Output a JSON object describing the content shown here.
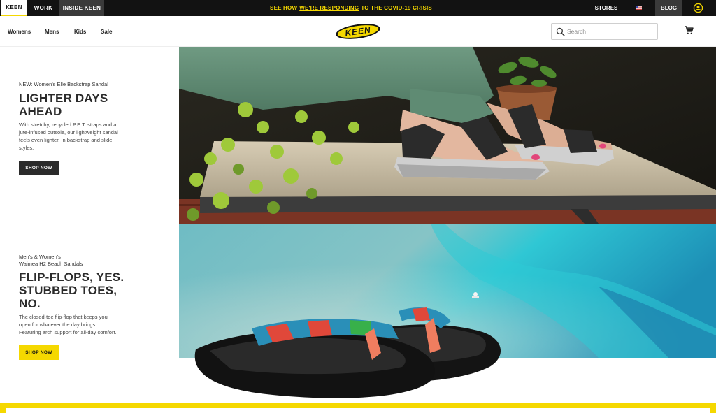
{
  "topbar": {
    "tabs": [
      {
        "label": "KEEN"
      },
      {
        "label": "WORK"
      },
      {
        "label": "INSIDE KEEN"
      }
    ],
    "covid": {
      "prefix": "SEE HOW",
      "link": "WE'RE RESPONDING",
      "suffix": "TO THE COVID-19 CRISIS"
    },
    "stores": "STORES",
    "blog": "BLOG",
    "flag_icon": "us-flag-icon",
    "account_icon": "account-icon"
  },
  "nav": {
    "links": [
      "Womens",
      "Mens",
      "Kids",
      "Sale"
    ],
    "logo_text": "KEEN",
    "search_placeholder": "Search",
    "cart_icon": "cart-icon"
  },
  "hero1": {
    "eyebrow": "NEW: Women's Elle Backstrap Sandal",
    "headline_line1": "LIGHTER DAYS",
    "headline_line2": "AHEAD",
    "body_line1": "With stretchy, recycled P.E.T. straps and a",
    "body_line2": "jute-infused outsole, our lightweight sandal",
    "body_line3": "feels even lighter. In backstrap and slide",
    "body_line4": "styles.",
    "cta": "SHOP NOW"
  },
  "hero2": {
    "eyebrow_line1": "Men's & Women's",
    "eyebrow_line2": "Waimea H2 Beach Sandals",
    "headline_line1": "FLIP-FLOPS, YES.",
    "headline_line2": "STUBBED TOES,",
    "headline_line3": "NO.",
    "body_line1": "The closed-toe flip-flop that keeps you",
    "body_line2": "open for whatever the day brings.",
    "body_line3": "Featuring arch support for all-day comfort.",
    "cta": "SHOP NOW"
  },
  "colors": {
    "brand_yellow": "#f5d800",
    "top_bar": "#121212",
    "dark_button": "#2b2b2b"
  }
}
